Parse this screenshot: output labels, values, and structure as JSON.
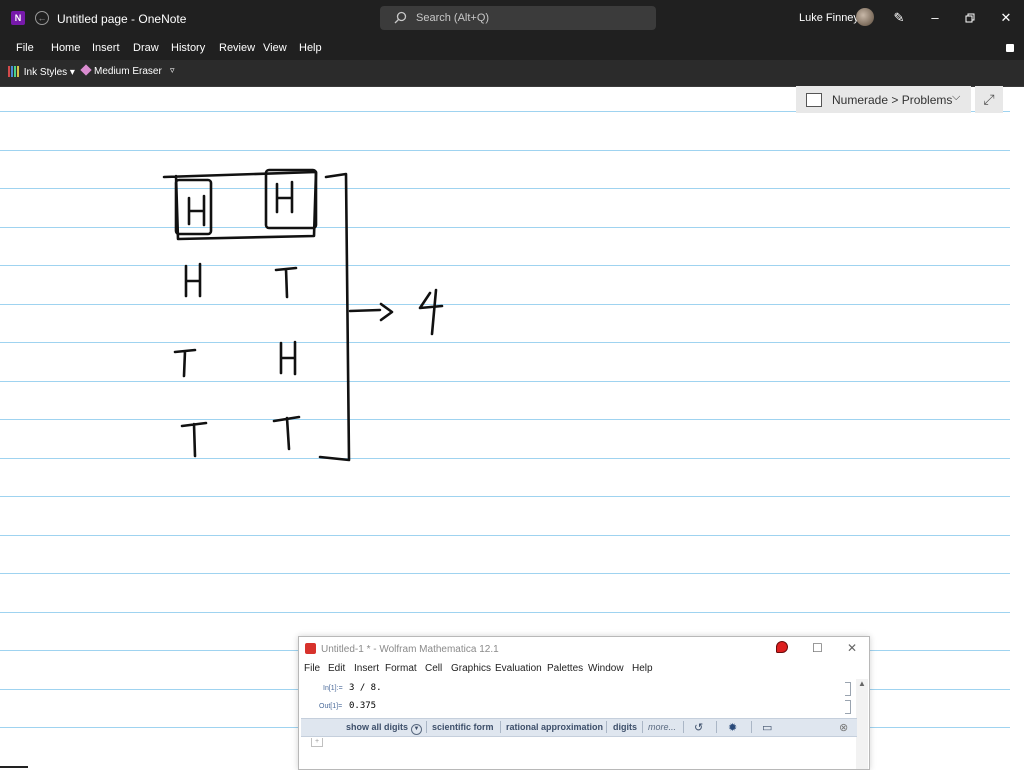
{
  "window": {
    "app_logo": "N",
    "title": "Untitled page  -  OneNote",
    "search_placeholder": "Search (Alt+Q)",
    "user_name": "Luke Finney",
    "icons": [
      "onenote-logo-icon",
      "back-icon",
      "search-icon",
      "pen-icon",
      "minimize-icon",
      "maximize-icon",
      "close-icon"
    ]
  },
  "menu": {
    "items": [
      "File",
      "Home",
      "Insert",
      "Draw",
      "History",
      "Review",
      "View",
      "Help"
    ]
  },
  "ink_toolbar": {
    "ink_styles_label": "Ink Styles",
    "eraser_label": "Medium Eraser"
  },
  "page": {
    "breadcrumb": "Numerade > Problems",
    "ink_text": {
      "outcomes": [
        [
          "H",
          "H"
        ],
        [
          "H",
          "T"
        ],
        [
          "T",
          "H"
        ],
        [
          "T",
          "T"
        ]
      ],
      "arrow": "—>",
      "count": "4"
    }
  },
  "mathematica": {
    "title": "Untitled-1 * - Wolfram Mathematica 12.1",
    "menu": [
      "File",
      "Edit",
      "Insert",
      "Format",
      "Cell",
      "Graphics",
      "Evaluation",
      "Palettes",
      "Window",
      "Help"
    ],
    "cells": [
      {
        "label": "In[1]:=",
        "content": "3 / 8."
      },
      {
        "label": "Out[1]=",
        "content": "0.375"
      }
    ],
    "suggestions": {
      "show_all_digits": "show all digits",
      "scientific_form": "scientific form",
      "rational_approximation": "rational approximation",
      "digits": "digits",
      "more": "more..."
    }
  },
  "colors": {
    "titlebar_bg": "#202020",
    "ruled_line": "#9fd3f0",
    "onenote_purple": "#7719aa",
    "mathematica_red": "#d7322c"
  }
}
